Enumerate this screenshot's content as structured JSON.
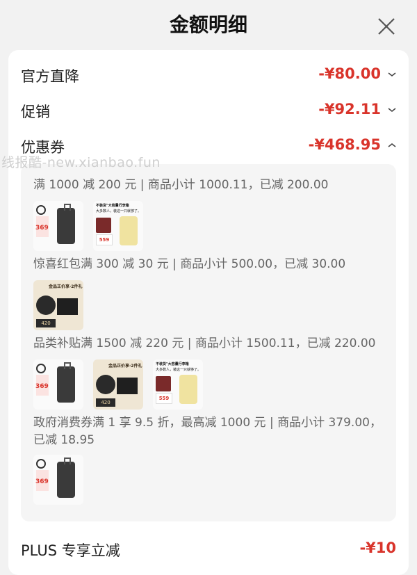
{
  "header": {
    "title": "金额明细"
  },
  "rows": [
    {
      "label": "官方直降",
      "amount": "-¥80.00",
      "chevron": "down"
    },
    {
      "label": "促销",
      "amount": "-¥92.11",
      "chevron": "down"
    },
    {
      "label": "优惠券",
      "amount": "-¥468.95",
      "chevron": "up"
    }
  ],
  "watermark": "线报酷-new.xianbao.fun",
  "coupons": [
    {
      "text": "满 1000 减 200 元 | 商品小计 1000.11，已减 200.00",
      "thumbs": [
        "luggage-black-thumb",
        "luggage-yellow-ad-thumb"
      ]
    },
    {
      "text": "惊喜红包满 300 减 30 元 | 商品小计 500.00，已减 30.00",
      "thumbs": [
        "cosmetic-gift-thumb"
      ]
    },
    {
      "text": "品类补贴满 1500 减 220 元 | 商品小计 1500.11，已减 220.00",
      "thumbs": [
        "luggage-black-thumb",
        "cosmetic-gift-thumb",
        "luggage-yellow-ad-thumb"
      ]
    },
    {
      "text": "政府消费券满 1 享 9.5 折，最高减 1000 元 | 商品小计 379.00，已减 18.95",
      "thumbs": [
        "luggage-black-thumb"
      ]
    }
  ],
  "thumb_text": {
    "price_369": "369",
    "price_559": "559",
    "price_420": "420",
    "ad_headline": "不装货\"大容量行李箱",
    "ad_sub": "大多数人，装这一只就够了。",
    "gift_headline": "金品正价享·2件礼"
  },
  "plus": {
    "label": "PLUS 专享立减",
    "amount": "-¥10"
  },
  "colors": {
    "accent": "#d9342b",
    "muted": "#666666",
    "panel": "#f5f5f5"
  }
}
